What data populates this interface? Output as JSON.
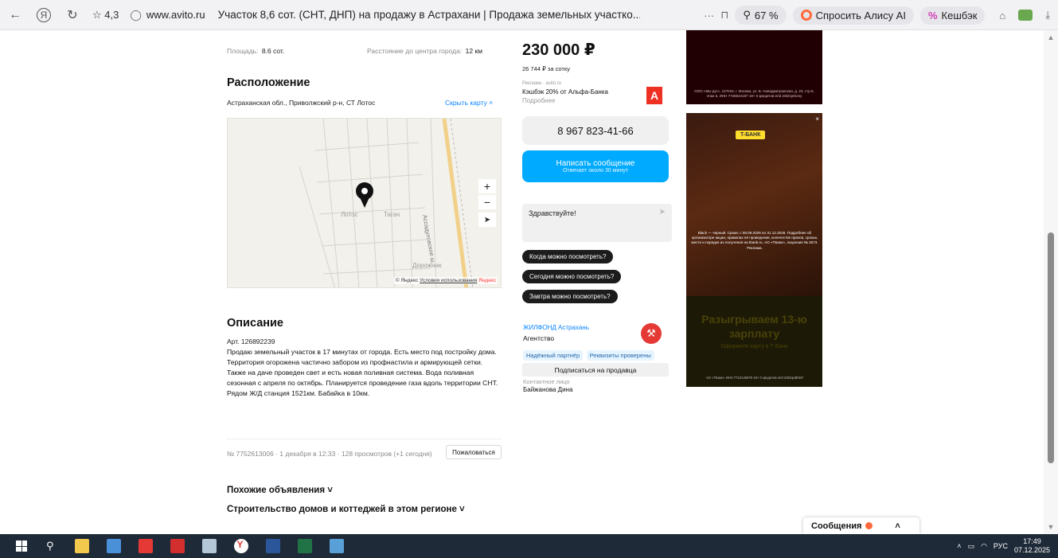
{
  "browser": {
    "rating": "☆ 4,3",
    "url": "www.avito.ru",
    "tab_title": "Участок 8,6 сот. (СНТ, ДНП) на продажу в Астрахани | Продажа земельных участко...",
    "zoom": "67 %",
    "alice_label": "Спросить Алису AI",
    "cashback_label": "Кешбэк"
  },
  "listing": {
    "area_label": "Площадь:",
    "area_value": "8.6 сот.",
    "distance_label": "Расстояние до центра города:",
    "distance_value": "12 км",
    "location_heading": "Расположение",
    "address": "Астраханская обл., Приволжский р-н, СТ Лотос",
    "hide_map": "Скрыть карту",
    "map_label_lotos": "Лотос",
    "map_label_tagach": "Тагач",
    "map_label_road": "Дорожник",
    "map_label_street": "Ассадуловское ш.",
    "map_copyright": "© Яндекс",
    "map_terms": "Условия использования",
    "map_brand": "Яндекс",
    "description_heading": "Описание",
    "article": "Арт. 126892239",
    "description": "Продаю земельный участок в 17 минутах от города. Есть место под постройку дома. Территория огорожена частично забором из профнастила и армирующей сетки. Также на даче проведен свет и есть новая поливная система. Вода поливная сезонная с апреля по октябрь. Планируется проведение газа вдоль территории СНТ. Рядом Ж/Д станция 1521км. Бабайка в 10км.",
    "meta": "№ 7752613006 · 1 декабря в 12:33 · 128 просмотров (+1 сегодня)",
    "report_button": "Пожаловаться",
    "similar": "Похожие объявления",
    "construction": "Строительство домов и коттеджей в этом регионе"
  },
  "seller": {
    "price": "230 000 ₽",
    "price_per": "26 744 ₽ за сотку",
    "ad_label": "Реклама · avito.ru",
    "cashback_offer": "Кэшбэк 20% от Альфа-Банка",
    "more": "Подробнее",
    "phone": "8 967 823-41-66",
    "write_message": "Написать сообщение",
    "reply_time": "Отвечает около 30 минут",
    "message_placeholder": "Здравствуйте!",
    "quick_replies": [
      "Когда можно посмотреть?",
      "Сегодня можно посмотреть?",
      "Завтра можно посмотреть?"
    ],
    "agency_name": "ЖИЛФОНД Астрахань",
    "agency_type": "Агентство",
    "tags": [
      "Надёжный партнёр",
      "Реквизиты проверены"
    ],
    "subscribe": "Подписаться на продавца",
    "contact_label": "Контактное лицо",
    "contact_name": "Байжанова Дина"
  },
  "ads": {
    "ad1_text": "ООО «Мы рус», 127015, г. Москва, ул. Б. Новодмитровская, д. 23, стр.6, этаж 6, ИНН 7728624187 18+ 0 кредитов erid 2SDnjeSony",
    "ad2_badge": "T-БАНК",
    "ad2_text": "Black — черный. Сроки: с 08.09.2025 по 31.12.2026. Подробнее об организаторе акции, правилах её проведения, количестве призов, сроках, месте и порядке их получения на tbank.ru. АО «ТБанк», лицензия № 2673. Реклама.",
    "ad2_headline": "Разыгрываем 13-ю зарплату",
    "ad2_sub": "Оформите карту в Т-Банк",
    "ad2_footer": "АО «ТБанк» ИНН 7710140679 18+ 0 кредитов erid 2SDnjeBhSF"
  },
  "messages": {
    "label": "Сообщения"
  },
  "taskbar": {
    "lang": "РУС",
    "time": "17:49",
    "date": "07.12.2025"
  }
}
